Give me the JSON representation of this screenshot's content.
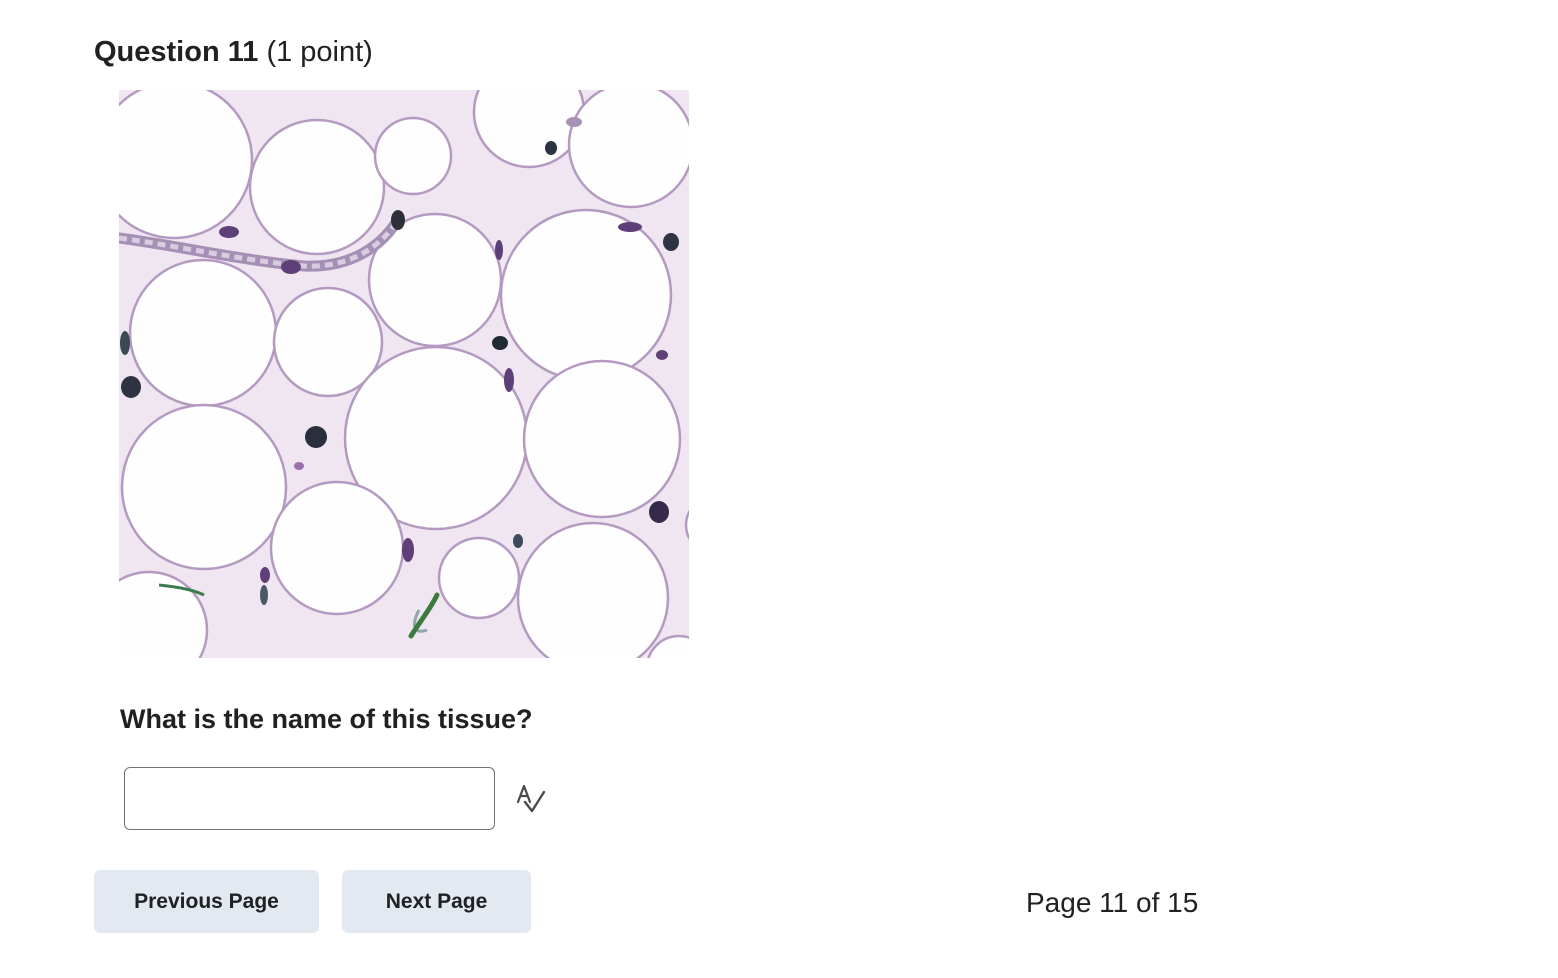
{
  "question": {
    "title": "Question 11",
    "points": "(1 point)",
    "prompt": "What is the name of this tissue?"
  },
  "answer": {
    "value": "",
    "placeholder": ""
  },
  "icons": {
    "spellcheck": "spellcheck-icon"
  },
  "navigation": {
    "previous_label": "Previous Page",
    "next_label": "Next Page",
    "page_indicator": "Page 11 of 15"
  },
  "colors": {
    "button_bg": "#e3e9f1",
    "text": "#202122",
    "input_border": "#6e7376"
  }
}
